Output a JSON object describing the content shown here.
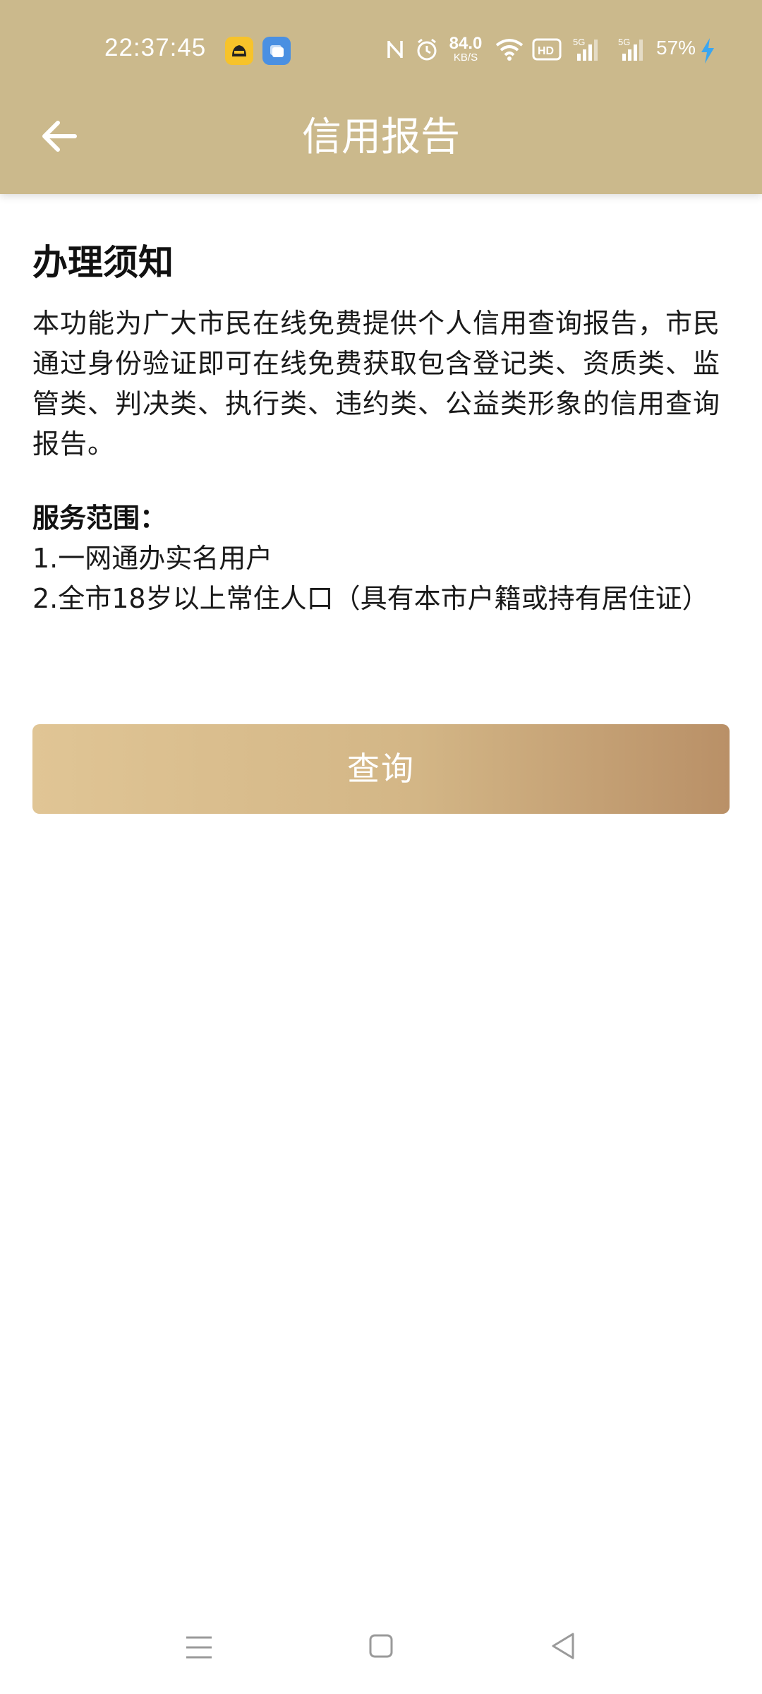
{
  "status_bar": {
    "time": "22:37:45",
    "net_speed_value": "84.0",
    "net_speed_unit": "KB/S",
    "network_hd": "HD",
    "signal_1": "5G",
    "signal_2": "5G",
    "battery": "57%"
  },
  "header": {
    "title": "信用报告",
    "back_icon": "arrow-left-icon",
    "background_color": "#cbb98c"
  },
  "notice": {
    "title": "办理须知",
    "description": "本功能为广大市民在线免费提供个人信用查询报告，市民通过身份验证即可在线免费获取包含登记类、资质类、监管类、判决类、执行类、违约类、公益类形象的信用查询报告。",
    "scope_label": "服务范围：",
    "scope_items": [
      "1.一网通办实名用户",
      "2.全市18岁以上常住人口（具有本市户籍或持有居住证）"
    ]
  },
  "query_button": {
    "label": "查询",
    "gradient_start": "#e0c595",
    "gradient_end": "#b99067"
  },
  "nav_bar": {
    "menu_icon": "menu-icon",
    "home_icon": "home-square-icon",
    "back_icon": "back-triangle-icon"
  }
}
